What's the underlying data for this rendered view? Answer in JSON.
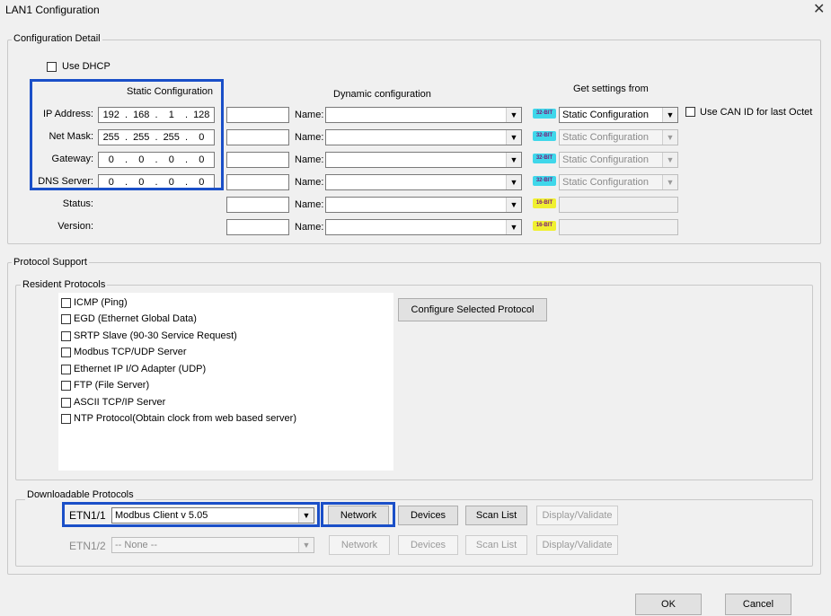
{
  "window": {
    "title": "LAN1 Configuration",
    "close_glyph": "✕"
  },
  "config_detail": {
    "group_label": "Configuration Detail",
    "use_dhcp_label": "Use DHCP",
    "static_header": "Static Configuration",
    "dynamic_header": "Dynamic configuration",
    "get_settings_header": "Get settings from",
    "use_can_label": "Use CAN ID for last Octet",
    "name_label": "Name:",
    "rows": [
      {
        "label": "IP Address:",
        "ip": [
          "192",
          "168",
          "1",
          "128"
        ],
        "badge": "32-BIT",
        "source": "Static Configuration",
        "source_enabled": true
      },
      {
        "label": "Net Mask:",
        "ip": [
          "255",
          "255",
          "255",
          "0"
        ],
        "badge": "32-BIT",
        "source": "Static Configuration",
        "source_enabled": false
      },
      {
        "label": "Gateway:",
        "ip": [
          "0",
          "0",
          "0",
          "0"
        ],
        "badge": "32-BIT",
        "source": "Static Configuration",
        "source_enabled": false
      },
      {
        "label": "DNS Server:",
        "ip": [
          "0",
          "0",
          "0",
          "0"
        ],
        "badge": "32-BIT",
        "source": "Static Configuration",
        "source_enabled": false
      },
      {
        "label": "Status:",
        "badge": "16-BIT"
      },
      {
        "label": "Version:",
        "badge": "16-BIT"
      }
    ]
  },
  "protocol_support": {
    "group_label": "Protocol Support",
    "resident_label": "Resident Protocols",
    "configure_button": "Configure Selected Protocol",
    "protocols": [
      "ICMP (Ping)",
      "EGD (Ethernet Global Data)",
      "SRTP Slave (90-30 Service Request)",
      "Modbus TCP/UDP Server",
      "Ethernet IP I/O Adapter (UDP)",
      "FTP (File Server)",
      "ASCII TCP/IP Server",
      "NTP Protocol(Obtain clock from web based server)"
    ],
    "downloadable_label": "Downloadable Protocols",
    "etn1": {
      "label": "ETN1/1",
      "value": "Modbus Client  v 5.05"
    },
    "etn2": {
      "label": "ETN1/2",
      "value": "-- None --"
    },
    "buttons": {
      "network": "Network",
      "devices": "Devices",
      "scan_list": "Scan List",
      "display_validate": "Display/Validate"
    }
  },
  "footer": {
    "ok": "OK",
    "cancel": "Cancel"
  },
  "colors": {
    "highlight": "#1a4fc8",
    "badge32": "#3fd7ea",
    "badge16": "#f0f030"
  }
}
